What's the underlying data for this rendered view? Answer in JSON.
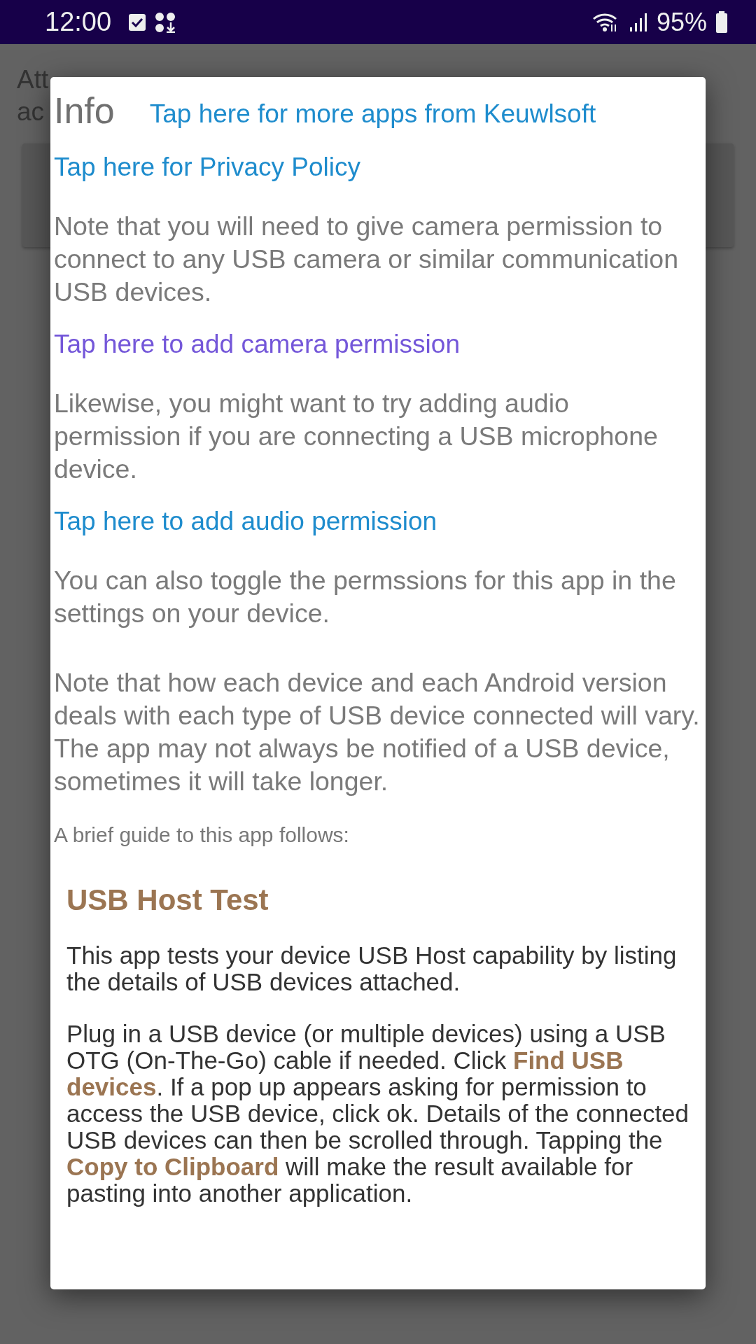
{
  "status_bar": {
    "time": "12:00",
    "battery": "95%"
  },
  "background": {
    "lines": [
      "Att",
      "ac"
    ]
  },
  "dialog": {
    "title": "Info",
    "blocks": [
      {
        "kind": "link",
        "text": "Tap here for more apps from Keuwlsoft",
        "visited": false
      },
      {
        "kind": "link",
        "text": "Tap here for Privacy Policy",
        "visited": false
      },
      {
        "kind": "note",
        "text": "Note that you will need to give camera permission to connect to any USB camera or similar communication USB devices."
      },
      {
        "kind": "link",
        "text": "Tap here to add camera permission",
        "visited": true
      },
      {
        "kind": "note",
        "text": "Likewise, you might want to try adding audio permission if you are connecting a USB microphone device."
      },
      {
        "kind": "link",
        "text": "Tap here to add audio permission",
        "visited": false
      },
      {
        "kind": "note",
        "text": "You can also toggle the permssions for this app in the settings on your device."
      },
      {
        "kind": "note",
        "text": "Note that how each device and each Android version deals with each type of USB device connected will vary. The app may not always be notified of a USB device, sometimes it will take longer."
      },
      {
        "kind": "small",
        "text": "A brief guide to this app follows:"
      },
      {
        "kind": "heading",
        "text": "USB Host Test"
      },
      {
        "kind": "paragraph",
        "text": "This app tests your device USB Host capability by listing the details of USB devices attached."
      },
      {
        "kind": "paragraph",
        "text": "Plug in a USB device (or multiple devices) using a USB OTG (On-The-Go) cable if needed. Click **Find USB devices**. If a pop up appears asking for permission to access the USB device, click ok. Details of the connected USB devices can then be scrolled through. Tapping the **Copy to Clipboard** will make the result available for pasting into another application."
      }
    ]
  }
}
